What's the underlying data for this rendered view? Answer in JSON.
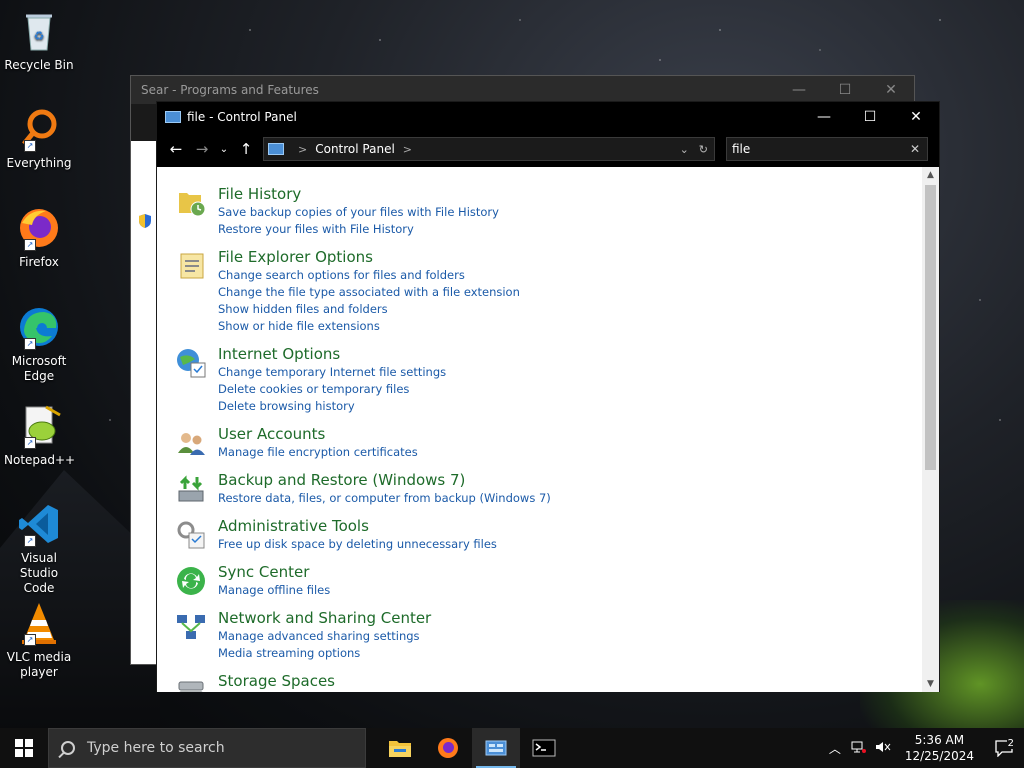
{
  "desktop": {
    "icons": [
      {
        "label": "Recycle Bin"
      },
      {
        "label": "Everything"
      },
      {
        "label": "Firefox"
      },
      {
        "label": "Microsoft Edge"
      },
      {
        "label": "Notepad++"
      },
      {
        "label": "Visual Studio Code"
      },
      {
        "label": "VLC media player"
      }
    ]
  },
  "back_window": {
    "title": "Sear - Programs and Features"
  },
  "window": {
    "title": "file - Control Panel",
    "minimize": "—",
    "maximize": "☐",
    "close": "✕"
  },
  "nav": {
    "back": "←",
    "forward": "→",
    "recent": "⌄",
    "up": "↑",
    "breadcrumb_root": "Control Panel",
    "sep": ">",
    "dropdown": "⌄",
    "refresh": "↻"
  },
  "search": {
    "value": "file",
    "clear": "✕"
  },
  "results": [
    {
      "title": "File History",
      "icon": "file-history-icon",
      "links": [
        "Save backup copies of your files with File History",
        "Restore your files with File History"
      ]
    },
    {
      "title": "File Explorer Options",
      "icon": "folder-options-icon",
      "links": [
        "Change search options for files and folders",
        "Change the file type associated with a file extension",
        "Show hidden files and folders",
        "Show or hide file extensions"
      ]
    },
    {
      "title": "Internet Options",
      "icon": "internet-options-icon",
      "links": [
        "Change temporary Internet file settings",
        "Delete cookies or temporary files",
        "Delete browsing history"
      ]
    },
    {
      "title": "User Accounts",
      "icon": "user-accounts-icon",
      "links": [
        "Manage file encryption certificates"
      ]
    },
    {
      "title": "Backup and Restore (Windows 7)",
      "icon": "backup-restore-icon",
      "links": [
        "Restore data, files, or computer from backup (Windows 7)"
      ]
    },
    {
      "title": "Administrative Tools",
      "icon": "admin-tools-icon",
      "links": [
        "Free up disk space by deleting unnecessary files"
      ]
    },
    {
      "title": "Sync Center",
      "icon": "sync-center-icon",
      "links": [
        "Manage offline files"
      ]
    },
    {
      "title": "Network and Sharing Center",
      "icon": "network-sharing-icon",
      "links": [
        "Manage advanced sharing settings",
        "Media streaming options"
      ]
    },
    {
      "title": "Storage Spaces",
      "icon": "storage-spaces-icon",
      "links": []
    }
  ],
  "taskbar": {
    "search_placeholder": "Type here to search",
    "time": "5:36 AM",
    "date": "12/25/2024",
    "notification_count": "2"
  },
  "colors": {
    "result_title": "#1e6b2a",
    "result_link": "#1b5aa8",
    "titlebar": "#000000"
  }
}
